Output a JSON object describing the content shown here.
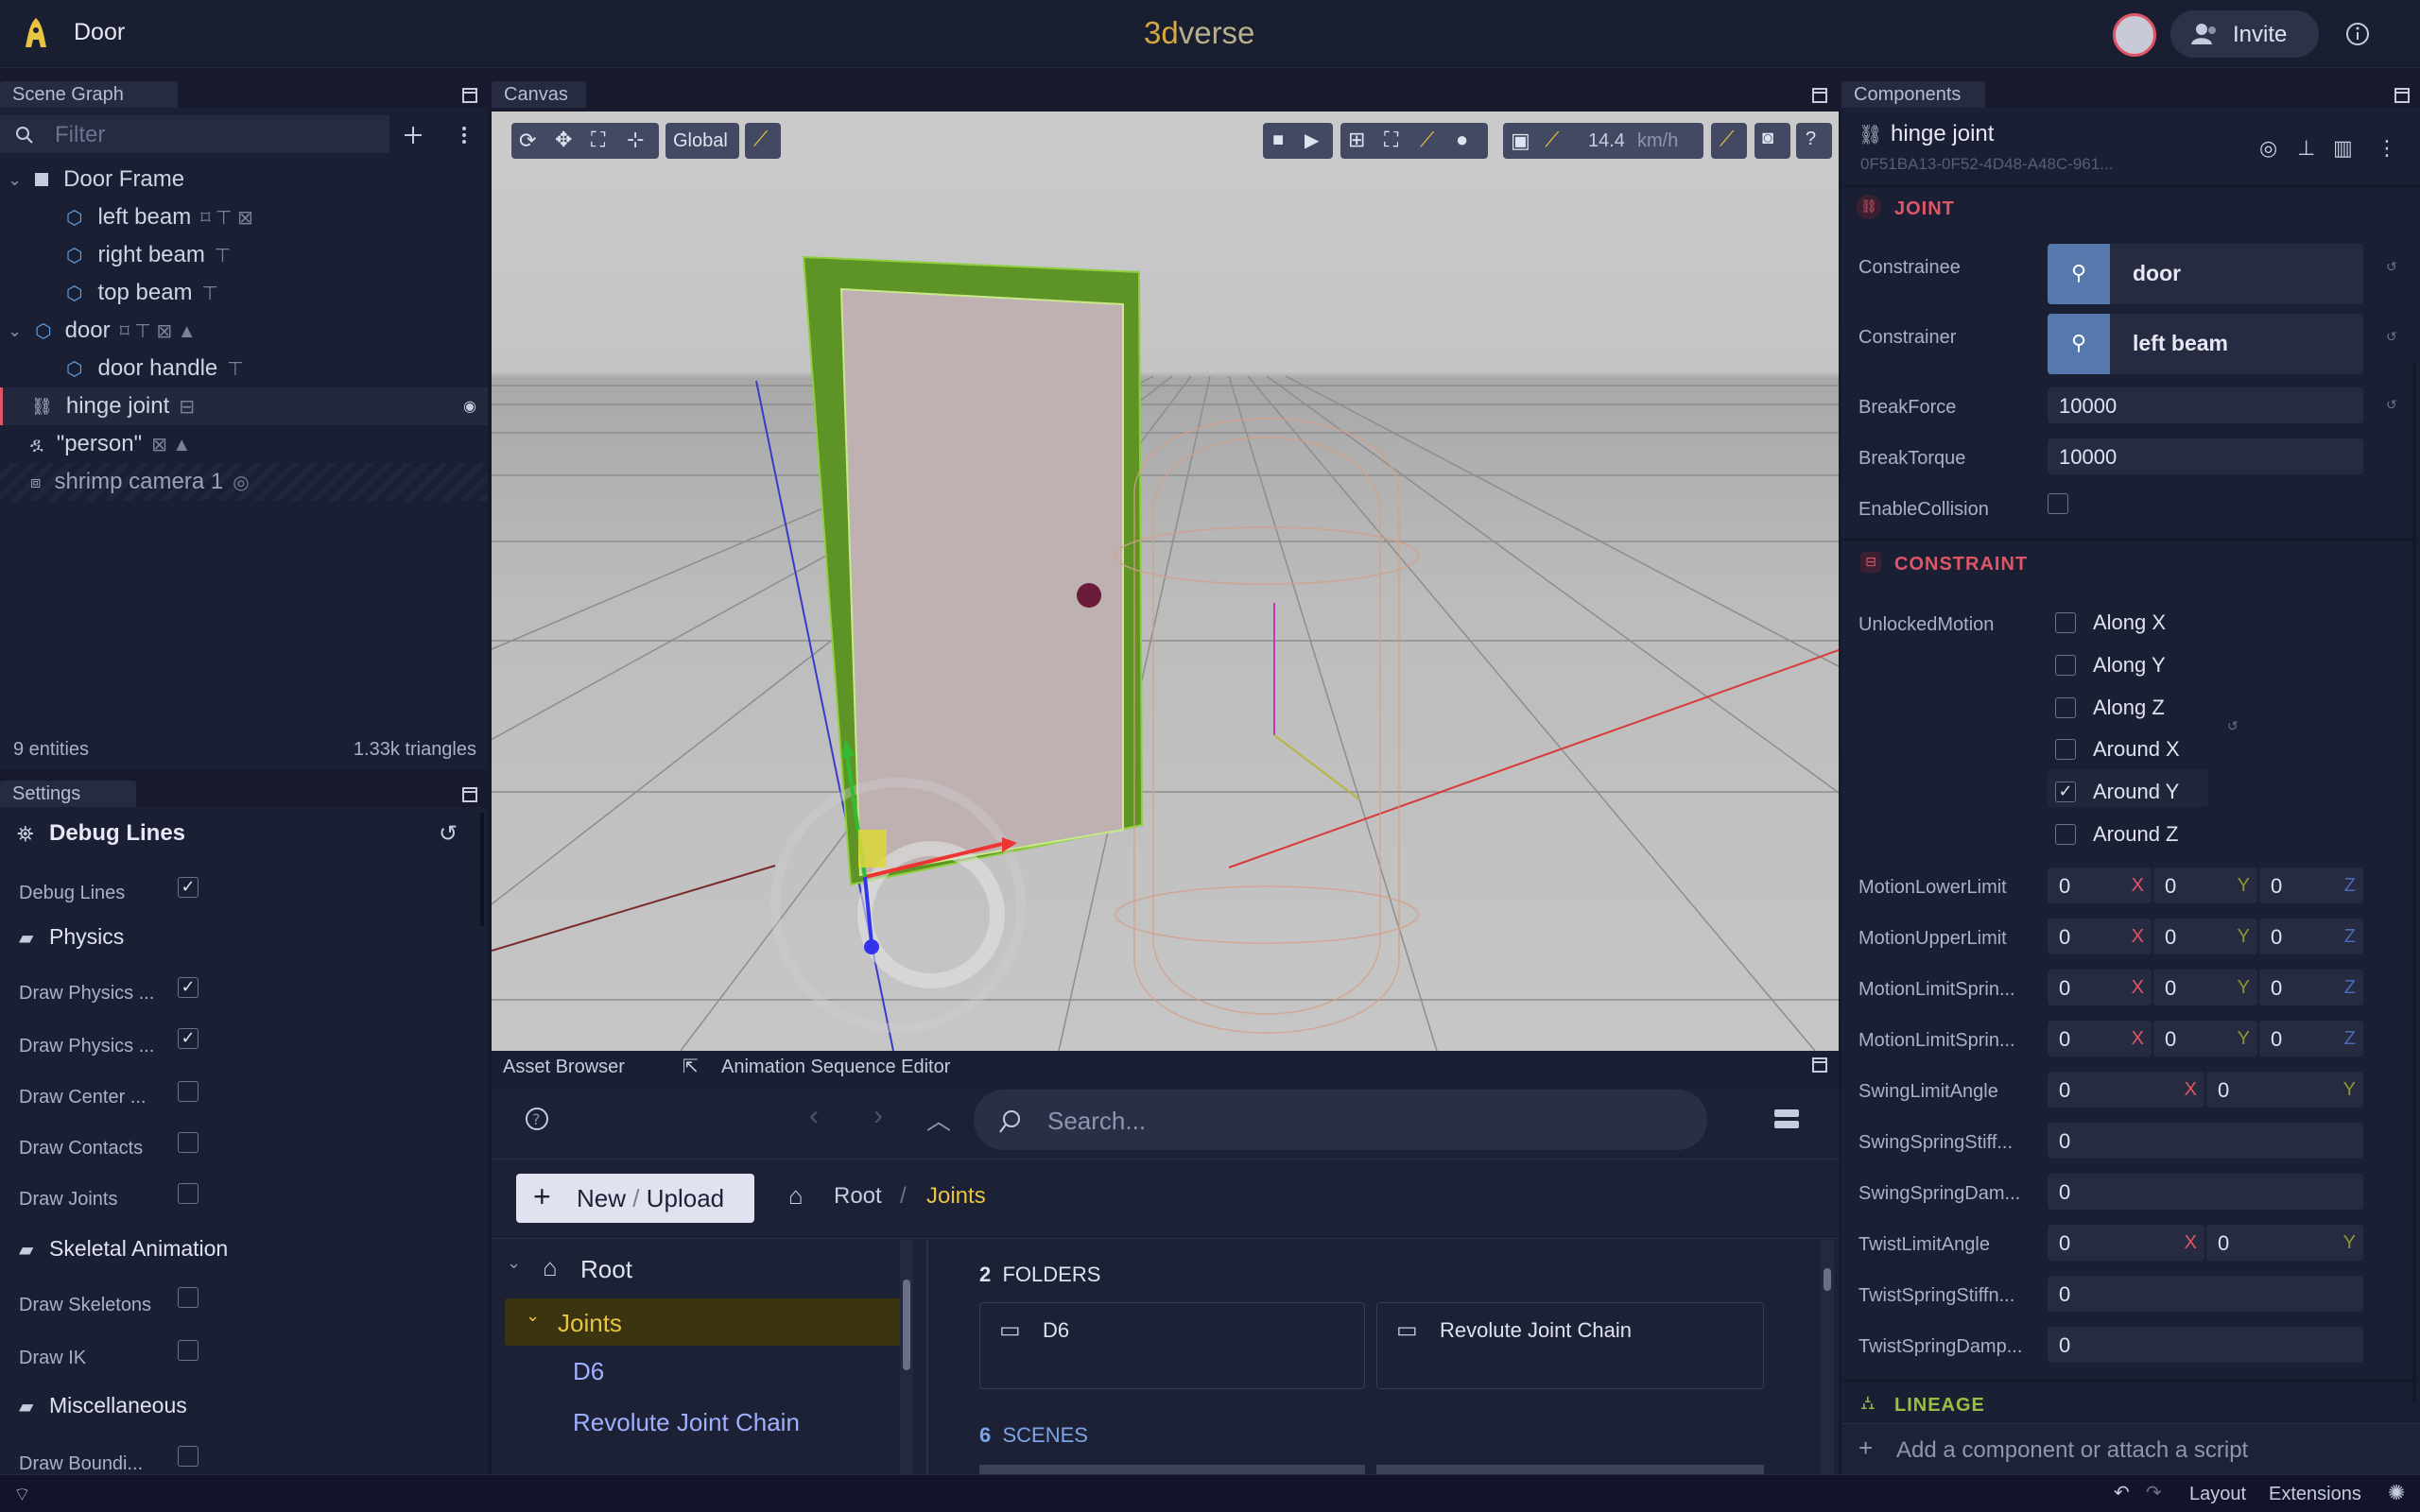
{
  "app": {
    "scene_name": "Door",
    "brand_a": "3d",
    "brand_b": "verse",
    "invite": "Invite"
  },
  "scene_graph": {
    "tab": "Scene Graph",
    "filter_placeholder": "Filter",
    "items": [
      "Door Frame",
      "left beam",
      "right beam",
      "top beam",
      "door",
      "door handle",
      "hinge joint",
      "\"person\"",
      "shrimp camera 1"
    ],
    "entities": "9 entities",
    "triangles": "1.33k triangles"
  },
  "settings": {
    "tab": "Settings",
    "section": "Debug Lines",
    "debug_lines": "Debug Lines",
    "physics": "Physics",
    "draw_physics_1": "Draw Physics ...",
    "draw_physics_2": "Draw Physics ...",
    "draw_center": "Draw Center ...",
    "draw_contacts": "Draw Contacts",
    "draw_joints": "Draw Joints",
    "skeletal": "Skeletal Animation",
    "draw_skeletons": "Draw Skeletons",
    "draw_ik": "Draw IK",
    "misc": "Miscellaneous",
    "draw_bounding": "Draw Boundi..."
  },
  "canvas": {
    "tab": "Canvas",
    "global": "Global",
    "speed": "14.4",
    "speed_unit": "km/h"
  },
  "asset_browser": {
    "tab": "Asset Browser",
    "tab2": "Animation Sequence Editor",
    "search_placeholder": "Search...",
    "new_label": "New",
    "slash": "/",
    "upload_label": "Upload",
    "crumb_root": "Root",
    "crumb_sep": "/",
    "crumb_current": "Joints",
    "tree": [
      "Root",
      "Joints",
      "D6",
      "Revolute Joint Chain"
    ],
    "folders_count": "2",
    "folders_label": "FOLDERS",
    "folders": [
      "D6",
      "Revolute Joint Chain"
    ],
    "scenes_count": "6",
    "scenes_label": "SCENES"
  },
  "components": {
    "tab": "Components",
    "name": "hinge joint",
    "uuid": "0F51BA13-0F52-4D48-A48C-961...",
    "joint": "JOINT",
    "constrainee": "Constrainee",
    "constrainee_val": "door",
    "constrainer": "Constrainer",
    "constrainer_val": "left beam",
    "breakforce": "BreakForce",
    "breakforce_val": "10000",
    "breaktorque": "BreakTorque",
    "breaktorque_val": "10000",
    "enable_collision": "EnableCollision",
    "constraint": "CONSTRAINT",
    "unlocked_motion": "UnlockedMotion",
    "motions": [
      "Along X",
      "Along Y",
      "Along Z",
      "Around X",
      "Around Y",
      "Around Z"
    ],
    "rows3": [
      "MotionLowerLimit",
      "MotionUpperLimit",
      "MotionLimitSprin...",
      "MotionLimitSprin..."
    ],
    "swing_limit": "SwingLimitAngle",
    "swing_stiff": "SwingSpringStiff...",
    "swing_damp": "SwingSpringDam...",
    "twist_limit": "TwistLimitAngle",
    "twist_stiff": "TwistSpringStiffn...",
    "twist_damp": "TwistSpringDamp...",
    "zero": "0",
    "x": "X",
    "y": "Y",
    "z": "Z",
    "lineage": "LINEAGE",
    "add": "Add a component or attach a script"
  },
  "status": {
    "layout": "Layout",
    "extensions": "Extensions"
  },
  "colors": {
    "accent": "#e8c440",
    "danger": "#e05666",
    "panel": "#1b1f33",
    "field": "#262b41"
  }
}
